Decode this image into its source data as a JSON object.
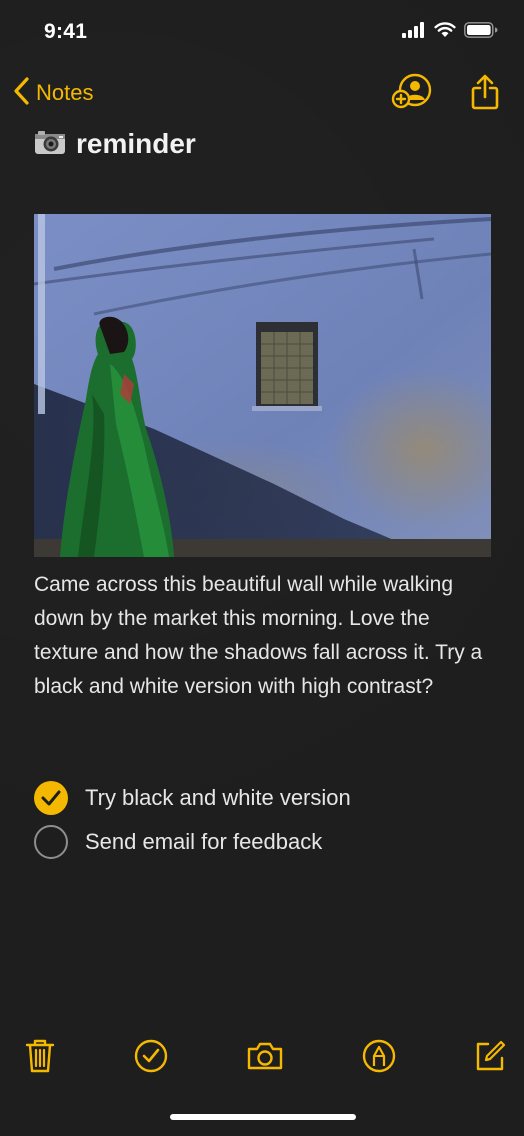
{
  "status_bar": {
    "time": "9:41",
    "icons": [
      "signal-icon",
      "wifi-icon",
      "battery-icon"
    ]
  },
  "nav": {
    "back_label": "Notes",
    "actions": [
      "add-person-icon",
      "share-icon"
    ]
  },
  "note": {
    "title_icon": "camera-icon",
    "title": "reminder",
    "body": "Came across this beautiful wall while walking down by the market this morning. Love the texture and how the shadows fall across it. Try a black and white version with high contrast?",
    "checklist": [
      {
        "label": "Try black and white version",
        "checked": true
      },
      {
        "label": "Send email for feedback",
        "checked": false
      }
    ]
  },
  "toolbar": {
    "items": [
      "trash-icon",
      "checklist-icon",
      "camera-icon",
      "markup-icon",
      "compose-icon"
    ]
  },
  "colors": {
    "accent": "#f5b800",
    "background": "#1e1e1e",
    "text": "#e6e6e6"
  }
}
